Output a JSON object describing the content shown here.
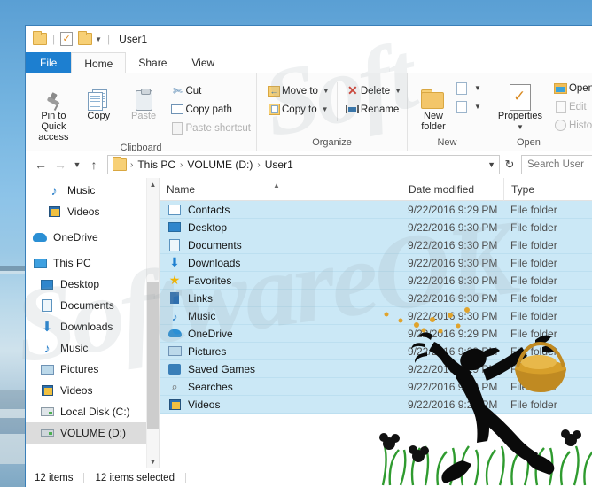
{
  "window": {
    "title": "User1",
    "quick_access": [
      "folder-icon",
      "properties-check-icon",
      "folder-icon",
      "dropdown-caret-icon"
    ]
  },
  "tabs": [
    {
      "label": "File",
      "state": "file"
    },
    {
      "label": "Home",
      "state": "active"
    },
    {
      "label": "Share",
      "state": "normal"
    },
    {
      "label": "View",
      "state": "normal"
    }
  ],
  "ribbon": {
    "groups": [
      {
        "name": "Clipboard",
        "label": "Clipboard",
        "big": [
          {
            "label": "Pin to Quick access",
            "icon": "pin-icon",
            "enabled": true
          },
          {
            "label": "Copy",
            "icon": "copy-icon",
            "enabled": true
          },
          {
            "label": "Paste",
            "icon": "paste-icon",
            "enabled": false
          }
        ],
        "small": [
          {
            "label": "Cut",
            "icon": "scissors-icon",
            "enabled": true,
            "caret": false
          },
          {
            "label": "Copy path",
            "icon": "copy-path-icon",
            "enabled": true,
            "caret": false
          },
          {
            "label": "Paste shortcut",
            "icon": "paste-shortcut-icon",
            "enabled": false,
            "caret": false
          }
        ]
      },
      {
        "name": "Organize",
        "label": "Organize",
        "small": [
          {
            "label": "Move to",
            "icon": "move-to-icon",
            "enabled": true,
            "caret": true
          },
          {
            "label": "Copy to",
            "icon": "copy-to-icon",
            "enabled": true,
            "caret": true
          }
        ],
        "small2": [
          {
            "label": "Delete",
            "icon": "delete-x-icon",
            "enabled": true,
            "caret": true
          },
          {
            "label": "Rename",
            "icon": "rename-icon",
            "enabled": true,
            "caret": false
          }
        ]
      },
      {
        "name": "New",
        "label": "New",
        "big": [
          {
            "label": "New folder",
            "icon": "new-folder-icon",
            "enabled": true
          }
        ],
        "small": [
          {
            "label": "",
            "icon": "new-item-icon",
            "enabled": true,
            "caret": true
          },
          {
            "label": "",
            "icon": "easy-access-icon",
            "enabled": true,
            "caret": true
          }
        ]
      },
      {
        "name": "Open",
        "label": "Open",
        "big": [
          {
            "label": "Properties",
            "icon": "properties-icon",
            "enabled": true,
            "caret": true
          }
        ],
        "small": [
          {
            "label": "Open",
            "icon": "open-folder-icon",
            "enabled": true,
            "caret": true
          },
          {
            "label": "Edit",
            "icon": "edit-icon",
            "enabled": false,
            "caret": false
          },
          {
            "label": "History",
            "icon": "history-icon",
            "enabled": false,
            "caret": false
          }
        ]
      }
    ]
  },
  "address": {
    "back_icon": "back-arrow-icon",
    "forward_icon": "forward-arrow-icon",
    "recent_icon": "recent-locations-caret-icon",
    "up_icon": "up-arrow-icon",
    "crumbs": [
      "This PC",
      "VOLUME (D:)",
      "User1"
    ],
    "dropdown_icon": "address-dropdown-icon",
    "refresh_icon": "refresh-icon",
    "search_placeholder": "Search User"
  },
  "navpane": {
    "items": [
      {
        "label": "Music",
        "icon": "music-note-icon",
        "indent": 2,
        "selected": false
      },
      {
        "label": "Videos",
        "icon": "video-icon",
        "indent": 2,
        "selected": false
      },
      {
        "label": "OneDrive",
        "icon": "onedrive-icon",
        "indent": 0,
        "selected": false
      },
      {
        "label": "This PC",
        "icon": "this-pc-icon",
        "indent": 0,
        "selected": false
      },
      {
        "label": "Desktop",
        "icon": "desktop-icon",
        "indent": 1,
        "selected": false
      },
      {
        "label": "Documents",
        "icon": "documents-icon",
        "indent": 1,
        "selected": false
      },
      {
        "label": "Downloads",
        "icon": "downloads-icon",
        "indent": 1,
        "selected": false
      },
      {
        "label": "Music",
        "icon": "music-note-icon",
        "indent": 1,
        "selected": false
      },
      {
        "label": "Pictures",
        "icon": "pictures-icon",
        "indent": 1,
        "selected": false
      },
      {
        "label": "Videos",
        "icon": "video-icon",
        "indent": 1,
        "selected": false
      },
      {
        "label": "Local Disk (C:)",
        "icon": "local-disk-icon",
        "indent": 1,
        "selected": false
      },
      {
        "label": "VOLUME (D:)",
        "icon": "drive-icon",
        "indent": 1,
        "selected": true
      }
    ]
  },
  "filelist": {
    "columns": [
      {
        "key": "name",
        "label": "Name",
        "sorted": "asc"
      },
      {
        "key": "date",
        "label": "Date modified"
      },
      {
        "key": "type",
        "label": "Type"
      }
    ],
    "rows": [
      {
        "name": "Contacts",
        "date": "9/22/2016 9:29 PM",
        "type": "File folder",
        "icon": "contacts-icon",
        "selected": true
      },
      {
        "name": "Desktop",
        "date": "9/22/2016 9:30 PM",
        "type": "File folder",
        "icon": "desktop-icon",
        "selected": true
      },
      {
        "name": "Documents",
        "date": "9/22/2016 9:30 PM",
        "type": "File folder",
        "icon": "documents-icon",
        "selected": true
      },
      {
        "name": "Downloads",
        "date": "9/22/2016 9:30 PM",
        "type": "File folder",
        "icon": "downloads-icon",
        "selected": true
      },
      {
        "name": "Favorites",
        "date": "9/22/2016 9:30 PM",
        "type": "File folder",
        "icon": "favorites-star-icon",
        "selected": true
      },
      {
        "name": "Links",
        "date": "9/22/2016 9:30 PM",
        "type": "File folder",
        "icon": "links-icon",
        "selected": true
      },
      {
        "name": "Music",
        "date": "9/22/2016 9:30 PM",
        "type": "File folder",
        "icon": "music-note-icon",
        "selected": true
      },
      {
        "name": "OneDrive",
        "date": "9/22/2016 9:29 PM",
        "type": "File folder",
        "icon": "onedrive-icon",
        "selected": true
      },
      {
        "name": "Pictures",
        "date": "9/22/2016 9:29 PM",
        "type": "File folder",
        "icon": "pictures-icon",
        "selected": true
      },
      {
        "name": "Saved Games",
        "date": "9/22/2016 9:29 PM",
        "type": "File folder",
        "icon": "saved-games-icon",
        "selected": true
      },
      {
        "name": "Searches",
        "date": "9/22/2016 9:29 PM",
        "type": "File folder",
        "icon": "search-icon",
        "selected": true
      },
      {
        "name": "Videos",
        "date": "9/22/2016 9:29 PM",
        "type": "File folder",
        "icon": "video-icon",
        "selected": true
      }
    ]
  },
  "statusbar": {
    "item_count": "12 items",
    "selected_count": "12 items selected"
  },
  "watermark": {
    "text": "SoftwareOK",
    "text2": "Soft"
  },
  "colors": {
    "file_tab_blue": "#1d7fd0",
    "selection_blue": "#cbe8f6",
    "nav_selected_gray": "#dcdcdc",
    "folder_yellow": "#f7d076",
    "window_border": "#3a7fb8"
  }
}
